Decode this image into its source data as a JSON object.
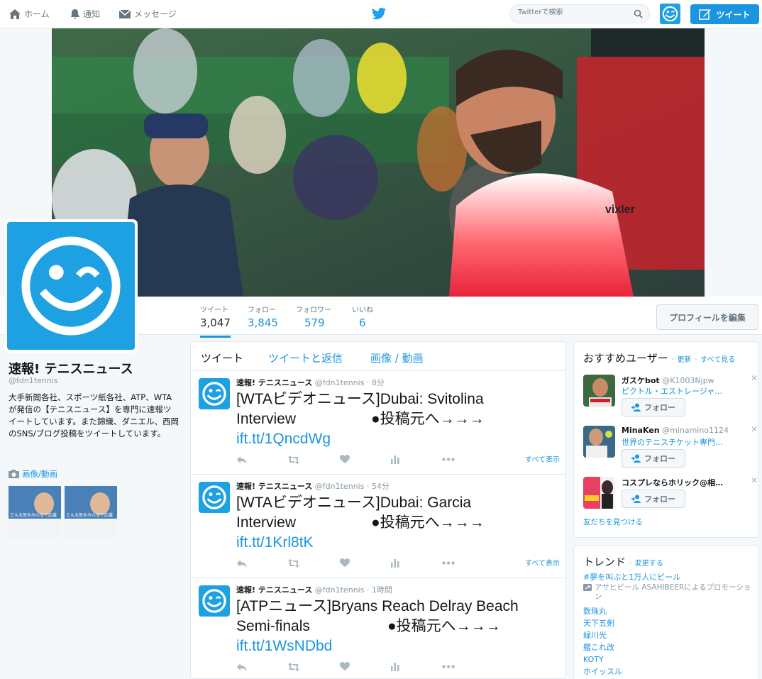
{
  "nav": {
    "home": "ホーム",
    "notifications": "通知",
    "messages": "メッセージ",
    "search_placeholder": "Twitterで検索",
    "tweet_button": "ツイート"
  },
  "profile": {
    "name": "速報! テニスニュース",
    "handle": "@fdn1tennis",
    "bio": "大手新聞各社、スポーツ紙各社、ATP、WTAが発信の【テニスニュース】を専門に速報ツイートしています。また錦織、ダニエル、西岡のSNS/ブログ投稿をツイートしています。",
    "media_heading": "画像/動画",
    "thumb_caption": "エル太郎をみんなで応援会"
  },
  "stats": [
    {
      "label": "ツイート",
      "value": "3,047"
    },
    {
      "label": "フォロー",
      "value": "3,845"
    },
    {
      "label": "フォロワー",
      "value": "579"
    },
    {
      "label": "いいね",
      "value": "6"
    }
  ],
  "edit_profile": "プロフィールを編集",
  "timeline": {
    "tabs": [
      "ツイート",
      "ツイートと返信",
      "画像 / 動画"
    ],
    "show_all": "すべて表示",
    "tweets": [
      {
        "name": "速報! テニスニュース",
        "handle": "@fdn1tennis",
        "time": "· 8分",
        "line1": "[WTAビデオニュース]Dubai: Svitolina",
        "line2a": "Interview",
        "line2b": "●投稿元へ→→→",
        "link": "ift.tt/1QncdWg"
      },
      {
        "name": "速報! テニスニュース",
        "handle": "@fdn1tennis",
        "time": "· 54分",
        "line1": "[WTAビデオニュース]Dubai: Garcia",
        "line2a": "Interview",
        "line2b": "●投稿元へ→→→",
        "link": "ift.tt/1Krl8tK"
      },
      {
        "name": "速報! テニスニュース",
        "handle": "@fdn1tennis",
        "time": "· 1時間",
        "line1": "[ATPニュース]Bryans Reach Delray Beach",
        "line2a": "Semi-finals",
        "line2b": "●投稿元へ→→→",
        "link": "ift.tt/1WsNDbd"
      }
    ]
  },
  "who_to_follow": {
    "title": "おすすめユーザー",
    "refresh": "更新",
    "view_all": "すべて見る",
    "follow_label": "フォロー",
    "find_friends": "友だちを見つける",
    "users": [
      {
        "name": "ガスケbot",
        "handle": "@K1003Njpw",
        "desc": "ピクトル・エストレージャ…"
      },
      {
        "name": "MinaKen",
        "handle": "@minamino1124",
        "desc": "世界のテニスチケット専門…"
      },
      {
        "name": "コスプレならホリック@相…",
        "handle": "",
        "desc": ""
      }
    ]
  },
  "trends": {
    "title": "トレンド",
    "change": "変更する",
    "promoted": "#夢を叫ぶと1万人にビール",
    "promoted_by": "アサヒビール ASAHIBEERによるプロモーション",
    "items": [
      "数珠丸",
      "天下五剣",
      "緑川光",
      "艦これ改",
      "KOTY",
      "ホイッスル"
    ]
  },
  "colors": {
    "accent": "#1b95e0",
    "avatar_bg": "#1da1e2"
  }
}
